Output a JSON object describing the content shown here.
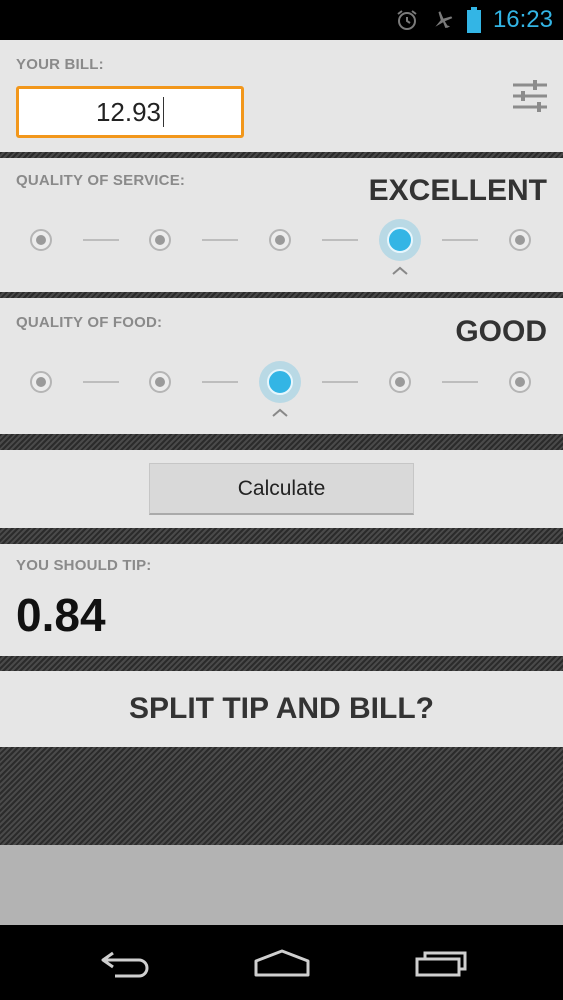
{
  "status_bar": {
    "time": "16:23",
    "icons": [
      "alarm-icon",
      "airplane-mode-icon",
      "battery-icon"
    ],
    "accent_color": "#33b5e5"
  },
  "bill": {
    "label": "YOUR BILL:",
    "value": "12.93",
    "settings_icon": "sliders-icon",
    "input_border_color": "#f2971b"
  },
  "service": {
    "label": "QUALITY OF SERVICE:",
    "value": "EXCELLENT",
    "levels": 5,
    "selected_index": 3
  },
  "food": {
    "label": "QUALITY OF FOOD:",
    "value": "GOOD",
    "levels": 5,
    "selected_index": 2
  },
  "calculate": {
    "button_label": "Calculate"
  },
  "tip": {
    "label": "YOU SHOULD TIP:",
    "value": "0.84"
  },
  "split": {
    "button_label": "SPLIT TIP AND BILL?"
  },
  "nav_bar": {
    "buttons": [
      "back-icon",
      "home-icon",
      "recent-apps-icon"
    ]
  },
  "colors": {
    "selected_dot": "#33b5e5",
    "panel_bg": "#e6e6e6"
  }
}
